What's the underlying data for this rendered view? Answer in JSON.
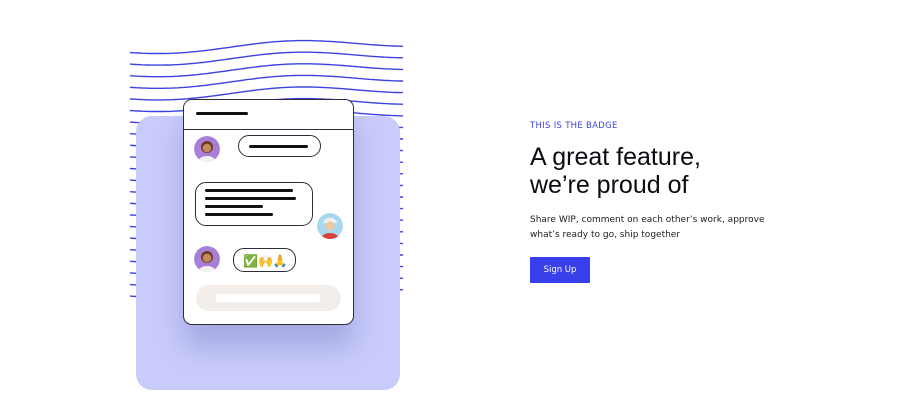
{
  "hero": {
    "eyebrow": "THIS IS THE BADGE",
    "headline_line1": "A great feature,",
    "headline_line2": "we’re proud of",
    "description": "Share WIP, comment on each other’s work, approve what’s ready to go, ship together",
    "cta_label": "Sign Up"
  },
  "illustration": {
    "chat_emojis": "✅🙌🙏",
    "colors": {
      "accent": "#3840ec",
      "wave": "#3b43e0",
      "card": "#c9ccfb",
      "compose": "#f3eeea"
    },
    "icons": [
      "avatar-person-icon",
      "avatar-person-icon",
      "avatar-person-icon"
    ]
  }
}
